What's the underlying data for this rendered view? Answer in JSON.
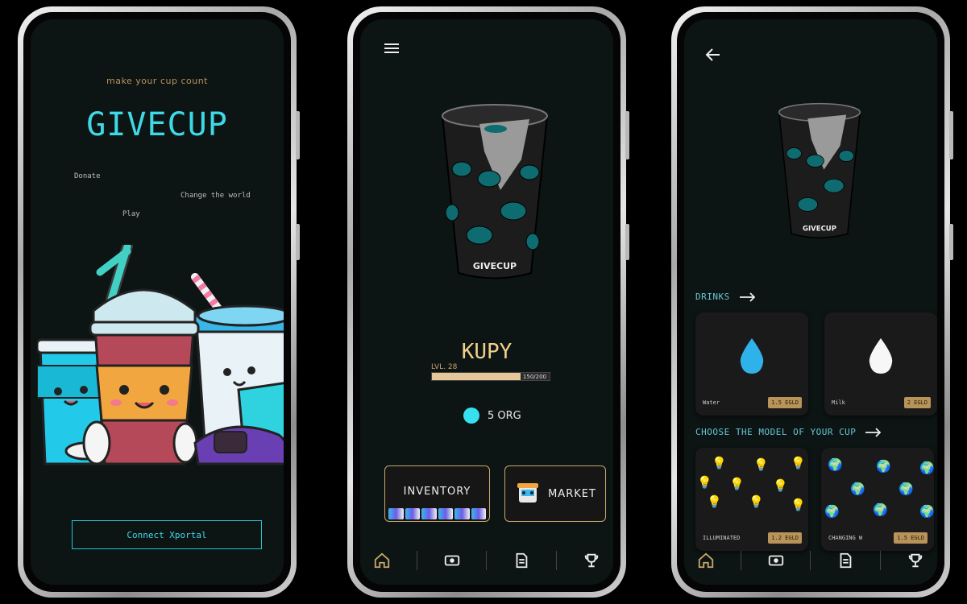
{
  "screen1": {
    "tagline": "make your cup count",
    "brand": "GIVECUP",
    "words": [
      "Donate",
      "Change the world",
      "Play"
    ],
    "connect_label": "Connect Xportal"
  },
  "screen2": {
    "cup_brand": "GIVECUP",
    "name": "KUPY",
    "level_label": "LVL. 28",
    "xp_text": "150/200",
    "xp_fraction": 0.75,
    "org_text": "5 ORG",
    "inventory_label": "INVENTORY",
    "market_label": "MARKET"
  },
  "screen3": {
    "cup_brand": "GIVECUP",
    "drinks_title": "DRINKS",
    "drinks": [
      {
        "name": "Water",
        "price": "1.5 EGLD"
      },
      {
        "name": "Milk",
        "price": "2 EGLD"
      }
    ],
    "models_title": "CHOOSE THE MODEL OF YOUR CUP",
    "models": [
      {
        "name": "ILLUMINATED",
        "price": "1.2 EGLD"
      },
      {
        "name": "CHANGING W",
        "price": "1.5 EGLD"
      }
    ]
  },
  "colors": {
    "accent_cyan": "#3fd9e6",
    "accent_gold": "#c7a76a",
    "screen_bg": "#0d1414"
  },
  "icons": [
    "menu-icon",
    "back-icon",
    "home-icon",
    "wallet-icon",
    "document-icon",
    "trophy-icon",
    "arrow-right-icon",
    "water-drop-icon",
    "milk-drop-icon",
    "lightbulb-icon",
    "globe-hands-icon"
  ]
}
